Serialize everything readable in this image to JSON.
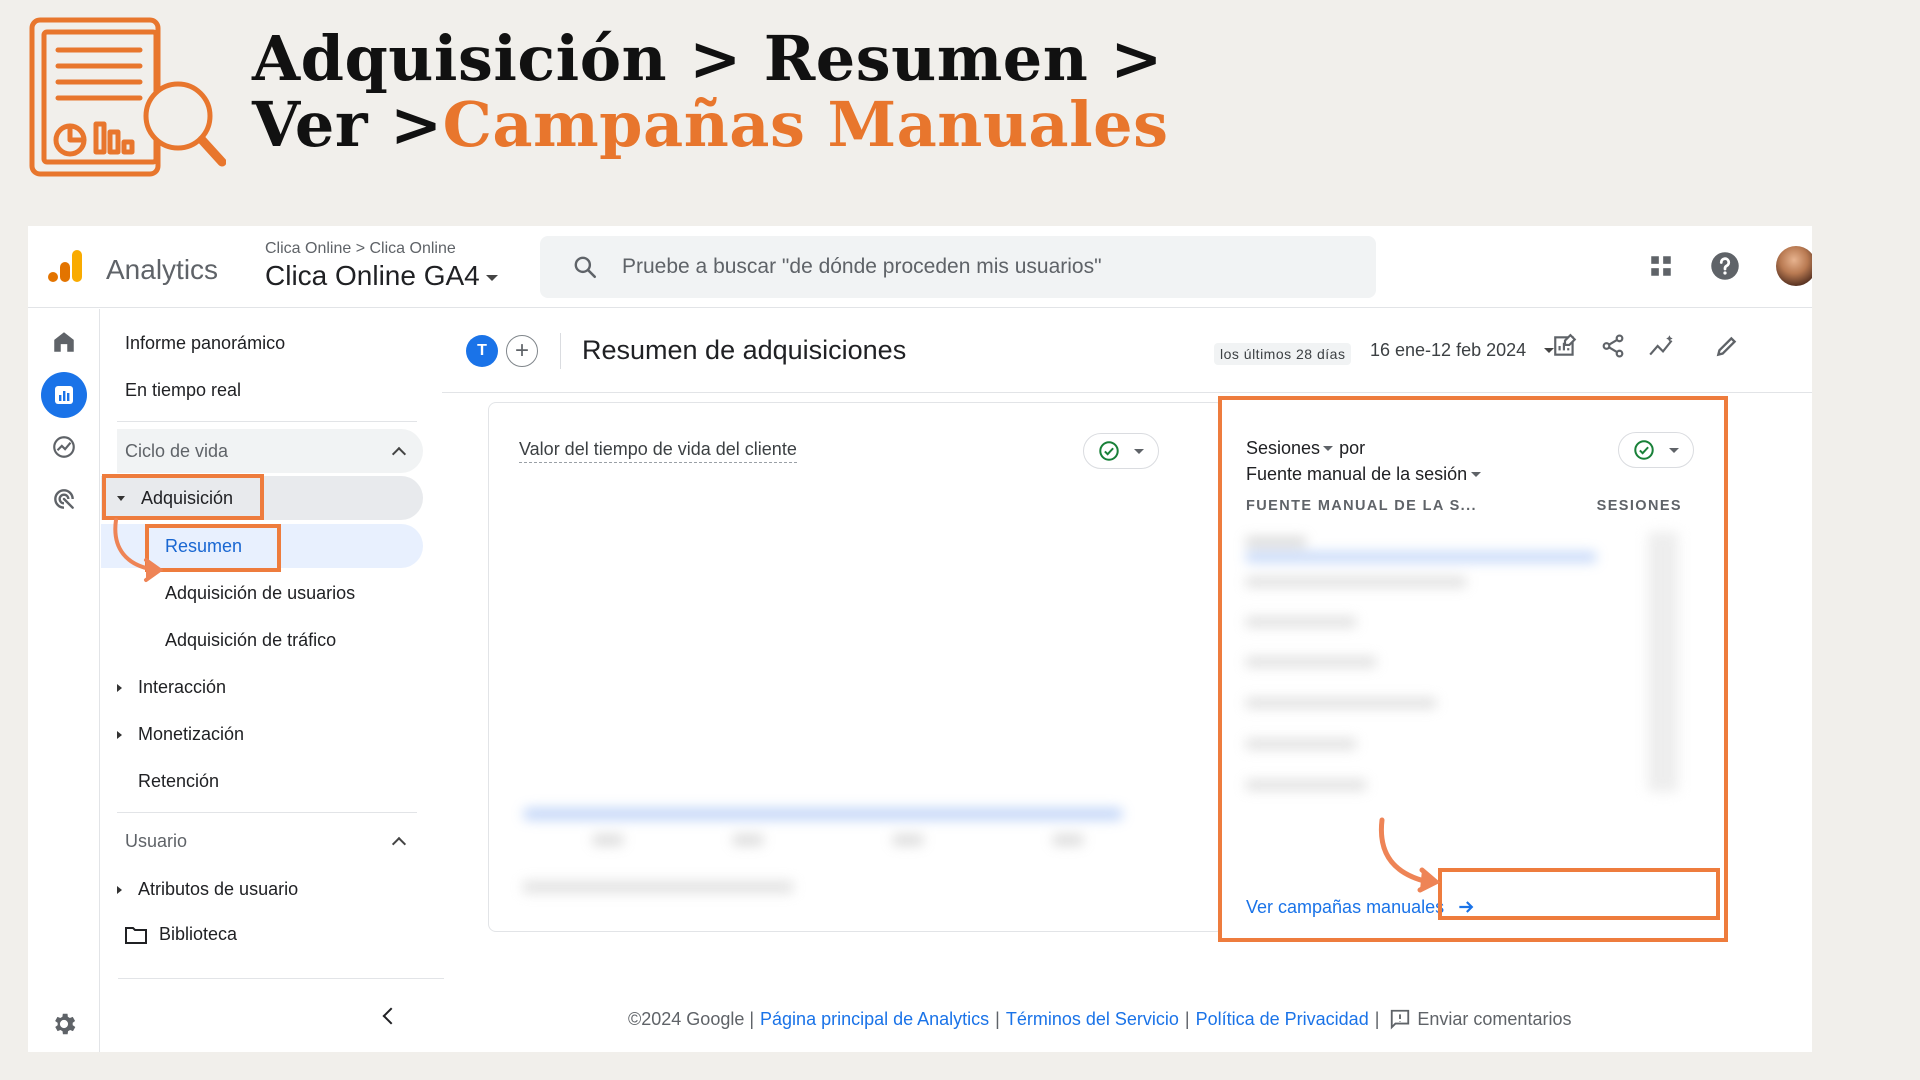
{
  "banner": {
    "line1": "Adquisición > Resumen >",
    "line2_prefix": "Ver >",
    "line2_accent": "Campañas Manuales"
  },
  "topbar": {
    "app_name": "Analytics",
    "breadcrumb": "Clica Online > Clica Online",
    "property": "Clica Online GA4",
    "search_placeholder": "Pruebe a buscar \"de dónde proceden mis usuarios\""
  },
  "nav": {
    "overview": "Informe panorámico",
    "realtime": "En tiempo real",
    "lifecycle": "Ciclo de vida",
    "acquisition": "Adquisición",
    "summary": "Resumen",
    "user_acquisition": "Adquisición de usuarios",
    "traffic_acquisition": "Adquisición de tráfico",
    "engagement": "Interacción",
    "monetization": "Monetización",
    "retention": "Retención",
    "user": "Usuario",
    "user_attributes": "Atributos de usuario",
    "library": "Biblioteca"
  },
  "header": {
    "badge": "T",
    "title": "Resumen de adquisiciones",
    "date_label": "los últimos 28 días",
    "date_range": "16 ene-12 feb 2024"
  },
  "card_ltv": {
    "title": "Valor del tiempo de vida del cliente"
  },
  "card_sessions": {
    "metric": "Sesiones",
    "by": "por",
    "dimension": "Fuente manual de la sesión",
    "col_dimension": "FUENTE MANUAL DE LA S...",
    "col_metric": "SESIONES",
    "link": "Ver campañas manuales"
  },
  "footer": {
    "copyright": "©2024 Google |",
    "home": "Página principal de Analytics",
    "sep": "|",
    "terms": "Términos del Servicio",
    "privacy": "Política de Privacidad",
    "feedback": "Enviar comentarios"
  },
  "colors": {
    "accent_orange": "#ee7c3d",
    "ga_blue": "#1a73e8"
  }
}
